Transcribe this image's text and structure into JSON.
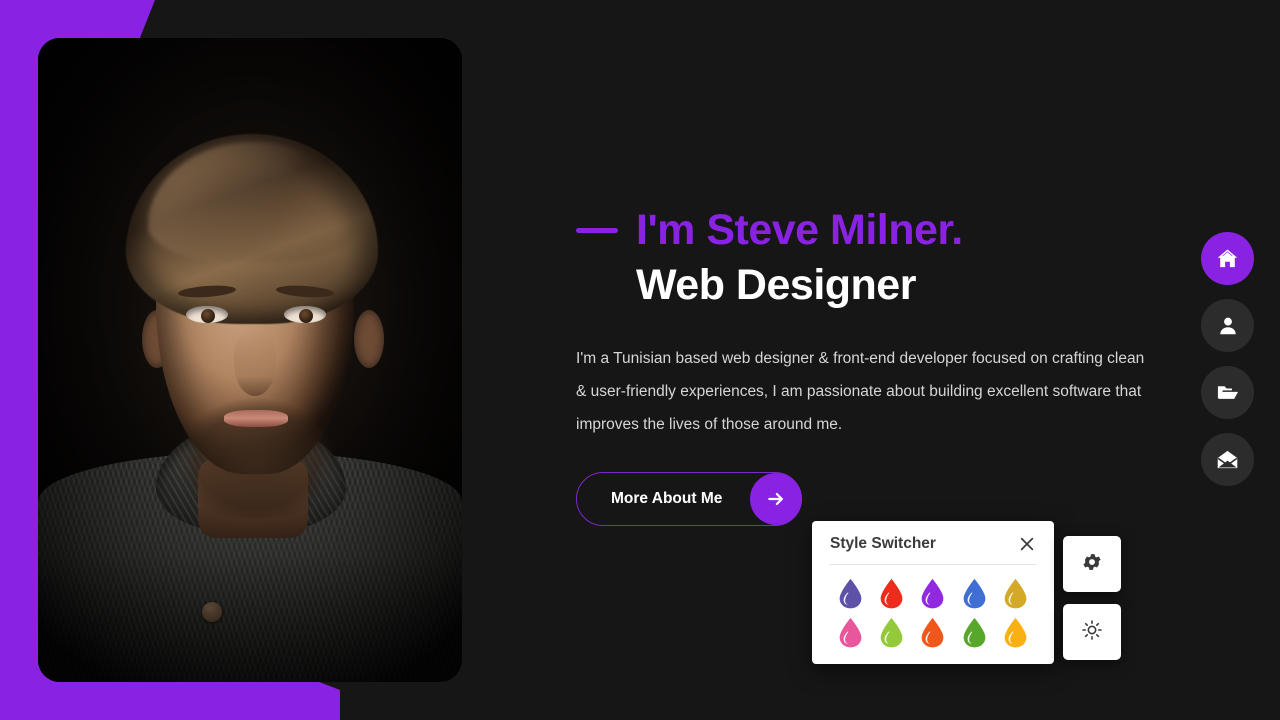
{
  "theme": {
    "accent": "#8A22E3",
    "background": "#161616",
    "panel_bg": "#ffffff",
    "nav_inactive_bg": "#2c2c2c",
    "heading_color": "#ffffff",
    "body_text_color": "#d6d6d6"
  },
  "hero": {
    "dash_icon": "dash-accent",
    "name": "I'm Steve Milner.",
    "role": "Web Designer",
    "description": "I'm a Tunisian based web designer & front-end developer focused on crafting clean & user-friendly experiences, I am passionate about building excellent software that improves the lives of those around me.",
    "cta_label": "More About Me",
    "cta_icon": "arrow-right-icon"
  },
  "portrait": {
    "alt": "portrait-photo"
  },
  "sidenav": {
    "items": [
      {
        "name": "home",
        "icon": "home-icon",
        "active": true
      },
      {
        "name": "about",
        "icon": "user-icon",
        "active": false
      },
      {
        "name": "portfolio",
        "icon": "folder-icon",
        "active": false
      },
      {
        "name": "contact",
        "icon": "envelope-icon",
        "active": false
      }
    ]
  },
  "style_switcher": {
    "title": "Style Switcher",
    "close_icon": "close-icon",
    "colors": [
      {
        "name": "slate-purple",
        "hex": "#5d51a8"
      },
      {
        "name": "red",
        "hex": "#ef2b1b"
      },
      {
        "name": "purple",
        "hex": "#9129e0"
      },
      {
        "name": "blue",
        "hex": "#3f6fd4"
      },
      {
        "name": "gold",
        "hex": "#d3a927"
      },
      {
        "name": "pink",
        "hex": "#e8579c"
      },
      {
        "name": "yellow-green",
        "hex": "#94ca3a"
      },
      {
        "name": "orange-red",
        "hex": "#f0571b"
      },
      {
        "name": "green",
        "hex": "#57a82a"
      },
      {
        "name": "amber",
        "hex": "#f8b013"
      }
    ]
  },
  "float_buttons": [
    {
      "name": "settings",
      "icon": "gear-icon"
    },
    {
      "name": "light-mode",
      "icon": "sun-icon"
    }
  ]
}
